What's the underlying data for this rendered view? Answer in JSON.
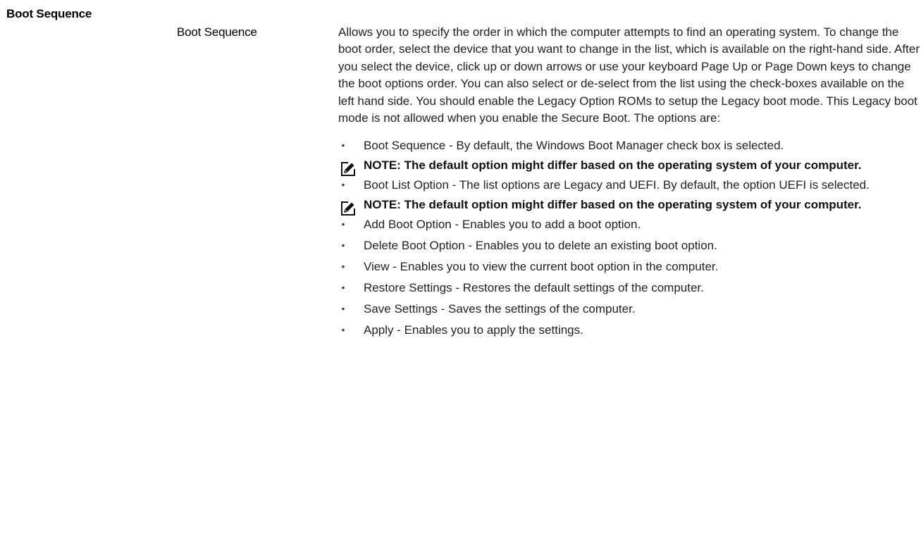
{
  "section_heading": "Boot Sequence",
  "option": {
    "name": "Boot Sequence",
    "description": "Allows you to specify the order in which the computer attempts to find an operating system. To change the boot order, select the device that you want to change in the list, which is available on the right-hand side. After you select the device, click up or down arrows or use your keyboard Page Up or Page Down keys to change the boot options order. You can also select or de-select from the list using the check-boxes available on the left hand side. You should enable the Legacy Option ROMs to setup the Legacy boot mode. This Legacy boot mode is not allowed when you enable the Secure Boot. The options are:"
  },
  "items": [
    "Boot Sequence - By default, the Windows Boot Manager check box is selected.",
    "Boot List Option - The list options are Legacy and UEFI. By default, the option UEFI is selected.",
    "Add Boot Option - Enables you to add a boot option.",
    "Delete Boot Option - Enables you to delete an existing boot option.",
    "View - Enables you to view the current boot option in the computer.",
    "Restore Settings - Restores the default settings of the computer.",
    "Save Settings - Saves the settings of the computer.",
    "Apply - Enables you to apply the settings."
  ],
  "notes": [
    "NOTE: The default option might differ based on the operating system of your computer.",
    "NOTE: The default option might differ based on the operating system of your computer."
  ],
  "icons": {
    "note": "pencil-note-icon"
  }
}
